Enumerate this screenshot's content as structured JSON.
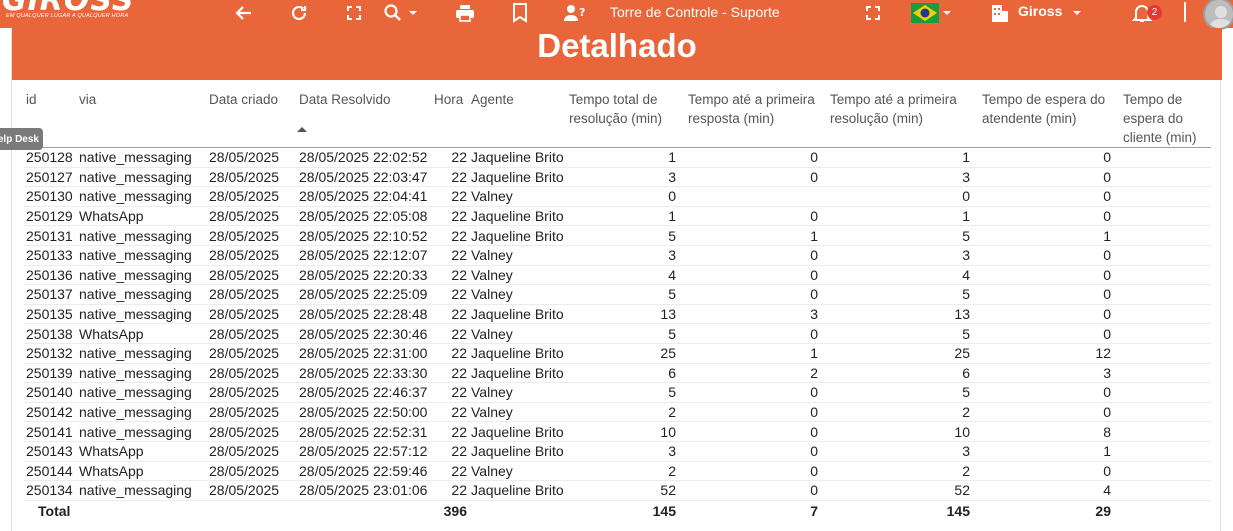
{
  "topbar": {
    "logo_text": "GIROSS",
    "logo_tagline": "EM QUALQUER LUGAR A QUALQUER HORA",
    "title": "Torre de Controle - Suporte",
    "company": "Giross",
    "notification_count": "2",
    "icons": [
      "back-arrow-icon",
      "refresh-icon",
      "fullscreen-icon",
      "search-icon",
      "print-icon",
      "bookmark-icon",
      "user-help-icon",
      "expand-icon",
      "brazil-flag-icon",
      "building-icon",
      "bell-icon",
      "avatar-icon"
    ]
  },
  "card": {
    "title": "Detalhado"
  },
  "helpdesk_tab": "Help Desk",
  "table": {
    "headers": {
      "id": "id",
      "via": "via",
      "criado": "Data criado",
      "resolvido": "Data Resolvido",
      "hora": "Hora",
      "agente": "Agente",
      "total": "Tempo total de resolução (min)",
      "primeira_resposta": "Tempo até a primeira resposta (min)",
      "primeira_resolucao": "Tempo até a primeira resolução (min)",
      "espera_atendente": "Tempo de espera do atendente (min)",
      "espera_cliente": "Tempo de espera do cliente (min)"
    },
    "rows": [
      [
        "250128",
        "native_messaging",
        "28/05/2025",
        "28/05/2025 22:02:52",
        "22",
        "Jaqueline Brito",
        "1",
        "0",
        "1",
        "0",
        ""
      ],
      [
        "250127",
        "native_messaging",
        "28/05/2025",
        "28/05/2025 22:03:47",
        "22",
        "Jaqueline Brito",
        "3",
        "0",
        "3",
        "0",
        ""
      ],
      [
        "250130",
        "native_messaging",
        "28/05/2025",
        "28/05/2025 22:04:41",
        "22",
        "Valney",
        "0",
        "",
        "0",
        "0",
        ""
      ],
      [
        "250129",
        "WhatsApp",
        "28/05/2025",
        "28/05/2025 22:05:08",
        "22",
        "Jaqueline Brito",
        "1",
        "0",
        "1",
        "0",
        ""
      ],
      [
        "250131",
        "native_messaging",
        "28/05/2025",
        "28/05/2025 22:10:52",
        "22",
        "Jaqueline Brito",
        "5",
        "1",
        "5",
        "1",
        ""
      ],
      [
        "250133",
        "native_messaging",
        "28/05/2025",
        "28/05/2025 22:12:07",
        "22",
        "Valney",
        "3",
        "0",
        "3",
        "0",
        ""
      ],
      [
        "250136",
        "native_messaging",
        "28/05/2025",
        "28/05/2025 22:20:33",
        "22",
        "Valney",
        "4",
        "0",
        "4",
        "0",
        ""
      ],
      [
        "250137",
        "native_messaging",
        "28/05/2025",
        "28/05/2025 22:25:09",
        "22",
        "Valney",
        "5",
        "0",
        "5",
        "0",
        ""
      ],
      [
        "250135",
        "native_messaging",
        "28/05/2025",
        "28/05/2025 22:28:48",
        "22",
        "Jaqueline Brito",
        "13",
        "3",
        "13",
        "0",
        ""
      ],
      [
        "250138",
        "WhatsApp",
        "28/05/2025",
        "28/05/2025 22:30:46",
        "22",
        "Valney",
        "5",
        "0",
        "5",
        "0",
        ""
      ],
      [
        "250132",
        "native_messaging",
        "28/05/2025",
        "28/05/2025 22:31:00",
        "22",
        "Jaqueline Brito",
        "25",
        "1",
        "25",
        "12",
        ""
      ],
      [
        "250139",
        "native_messaging",
        "28/05/2025",
        "28/05/2025 22:33:30",
        "22",
        "Jaqueline Brito",
        "6",
        "2",
        "6",
        "3",
        ""
      ],
      [
        "250140",
        "native_messaging",
        "28/05/2025",
        "28/05/2025 22:46:37",
        "22",
        "Valney",
        "5",
        "0",
        "5",
        "0",
        ""
      ],
      [
        "250142",
        "native_messaging",
        "28/05/2025",
        "28/05/2025 22:50:00",
        "22",
        "Valney",
        "2",
        "0",
        "2",
        "0",
        ""
      ],
      [
        "250141",
        "native_messaging",
        "28/05/2025",
        "28/05/2025 22:52:31",
        "22",
        "Jaqueline Brito",
        "10",
        "0",
        "10",
        "8",
        ""
      ],
      [
        "250143",
        "WhatsApp",
        "28/05/2025",
        "28/05/2025 22:57:12",
        "22",
        "Jaqueline Brito",
        "3",
        "0",
        "3",
        "1",
        ""
      ],
      [
        "250144",
        "WhatsApp",
        "28/05/2025",
        "28/05/2025 22:59:46",
        "22",
        "Valney",
        "2",
        "0",
        "2",
        "0",
        ""
      ],
      [
        "250134",
        "native_messaging",
        "28/05/2025",
        "28/05/2025 23:01:06",
        "22",
        "Jaqueline Brito",
        "52",
        "0",
        "52",
        "4",
        ""
      ]
    ],
    "totals": {
      "label": "Total",
      "hora": "396",
      "total": "145",
      "primeira_resposta": "7",
      "primeira_resolucao": "145",
      "espera_atendente": "29"
    }
  },
  "colors": {
    "brand": "#e8663a",
    "badge": "#e53935",
    "helpdesk_tab": "#7a7a7a"
  }
}
